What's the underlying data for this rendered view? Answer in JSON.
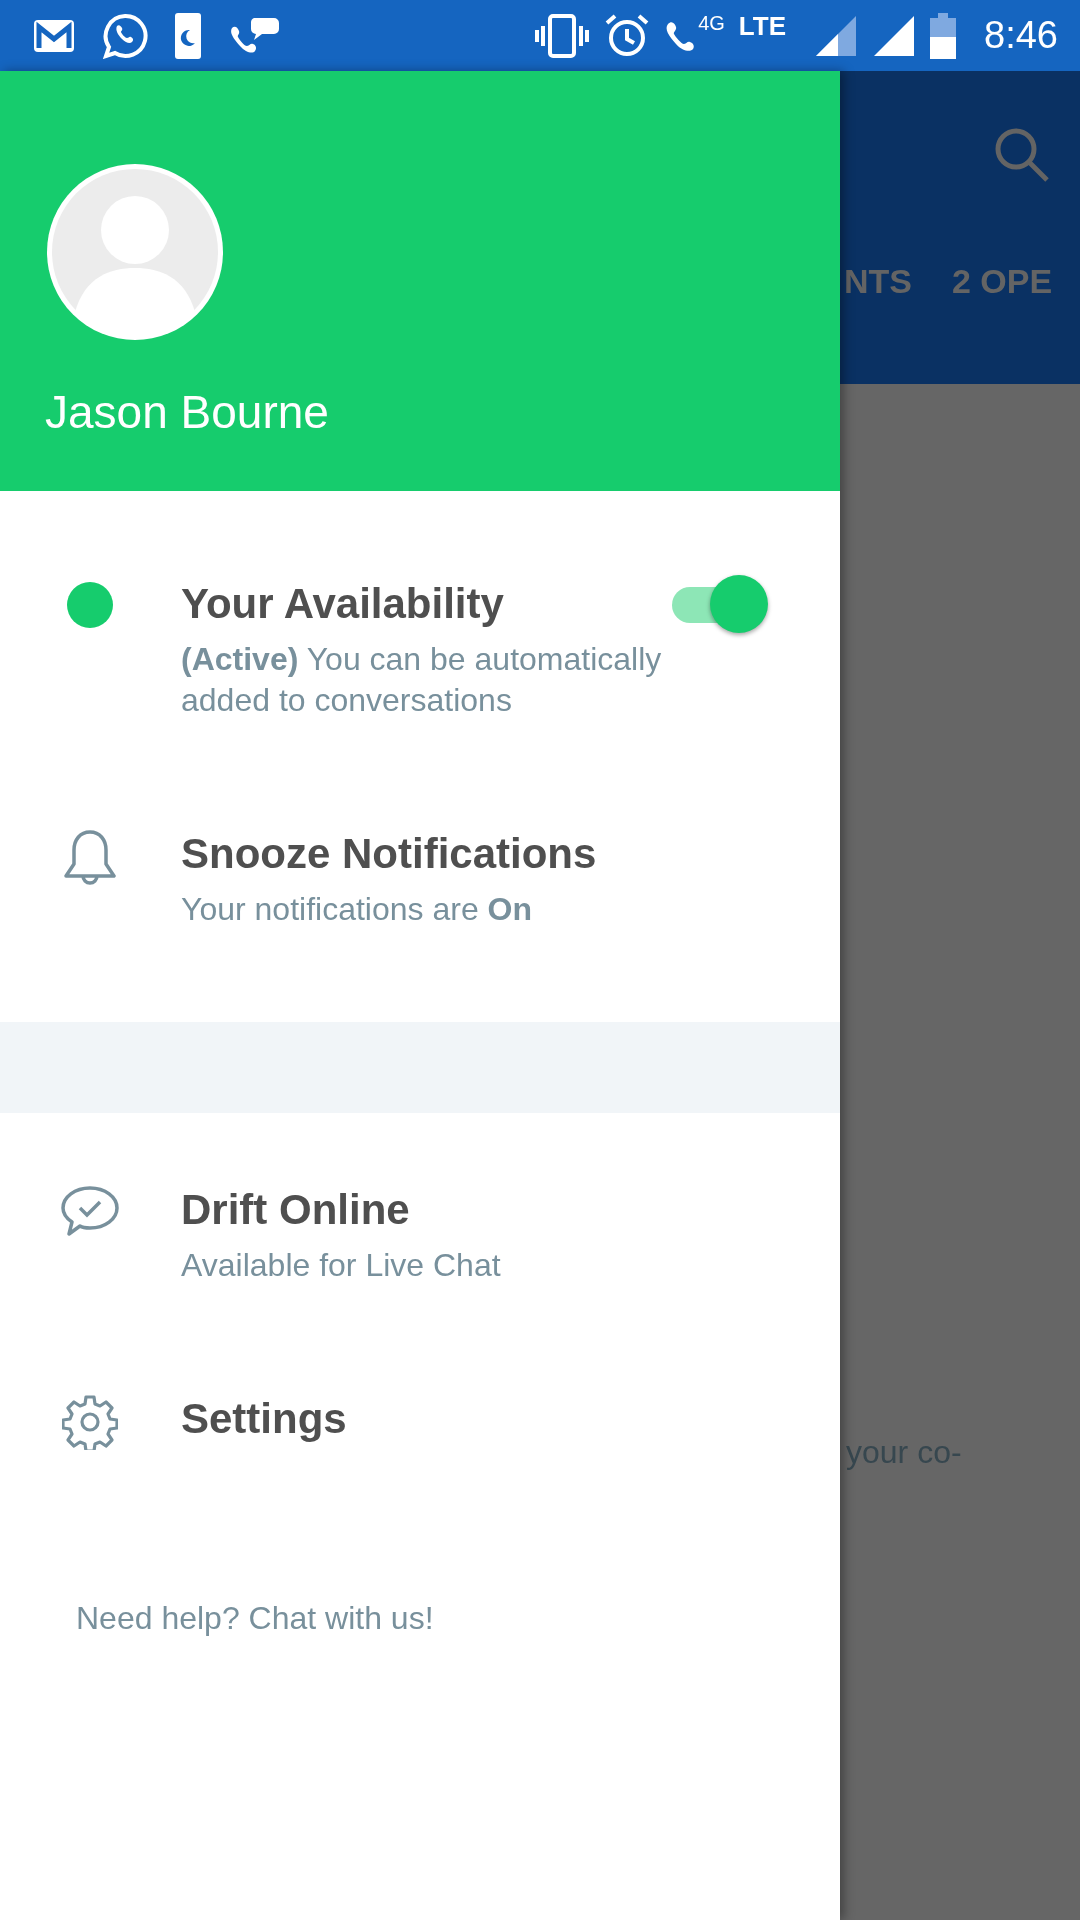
{
  "status_bar": {
    "data_label": "4G",
    "network": "LTE",
    "time": "8:46"
  },
  "drawer": {
    "user_name": "Jason Bourne",
    "items": [
      {
        "kind": "availability",
        "title": "Your Availability",
        "subtitle": "**(Active)** You can be automatically added to conversations",
        "on": true
      },
      {
        "kind": "notifications",
        "title": "Snooze Notifications",
        "subtitle": "Your notifications are **On**"
      },
      {
        "kind": "chat",
        "title": "Drift Online",
        "subtitle": "Available for Live Chat"
      },
      {
        "kind": "settings",
        "title": "Settings"
      }
    ],
    "help_link": "Need help? Chat with us!"
  },
  "background": {
    "tabs": [
      "NTS",
      "2 OPE"
    ],
    "body_text": "your co-"
  }
}
